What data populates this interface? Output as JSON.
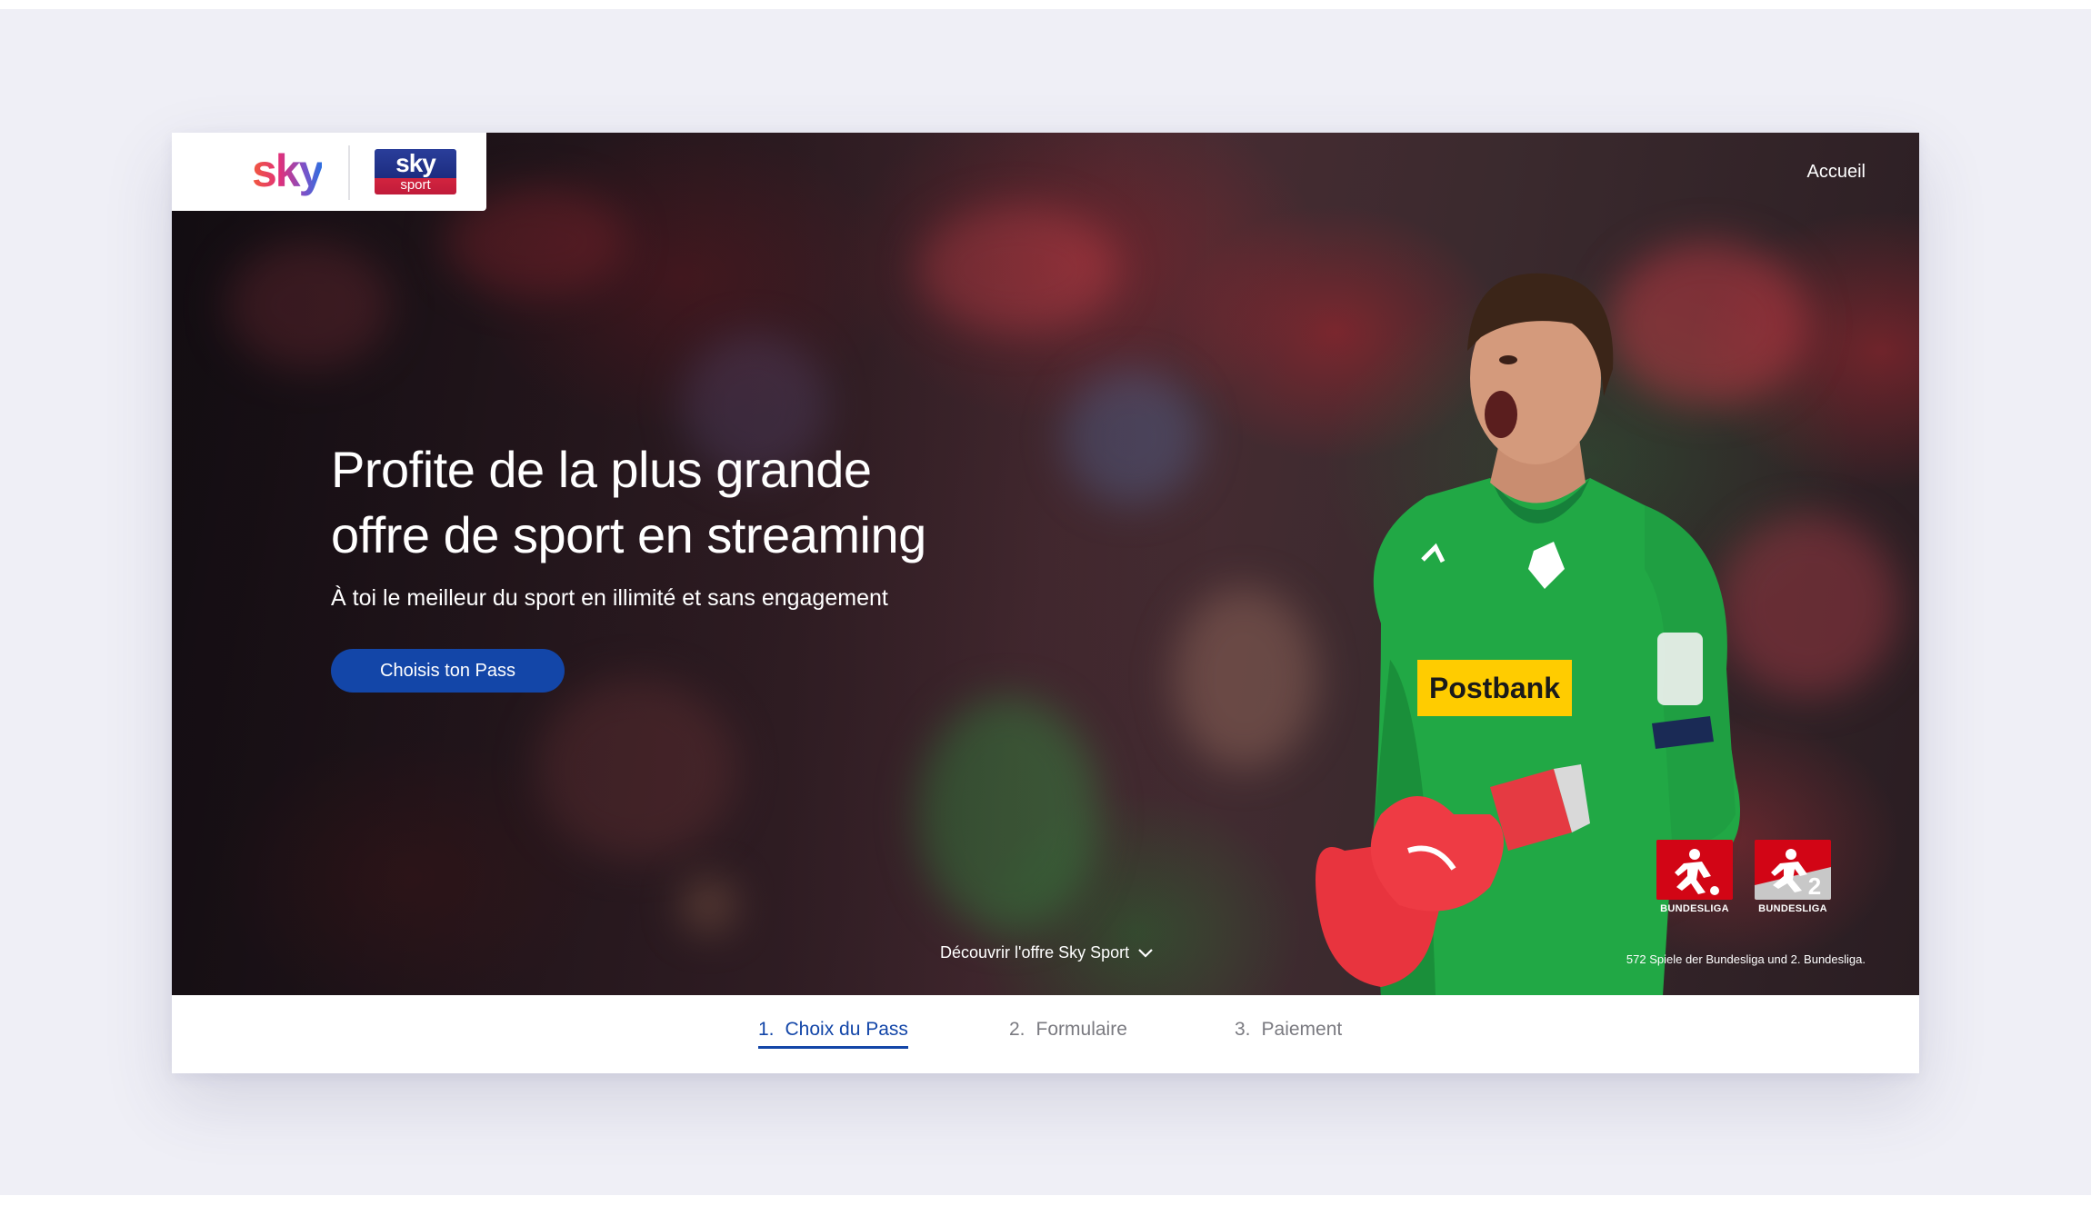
{
  "brand": {
    "sky_logo_text": "sky",
    "sky_sport_logo": {
      "top": "sky",
      "bottom": "sport"
    }
  },
  "nav": {
    "home_label": "Accueil"
  },
  "hero": {
    "headline_line1": "Profite de la plus grande",
    "headline_line2": "offre de sport en streaming",
    "subheadline": "À toi le meilleur du sport en illimité et sans engagement",
    "cta_label": "Choisis ton Pass",
    "discover_link": "Découvrir l'offre Sky Sport",
    "discover_icon": "chevron-down-icon",
    "player_jersey_sponsor": "Postbank"
  },
  "partners": {
    "logos": [
      {
        "icon": "bundesliga-logo-icon",
        "label": "BUNDESLIGA"
      },
      {
        "icon": "bundesliga-2-logo-icon",
        "label": "BUNDESLIGA"
      }
    ],
    "caption": "572 Spiele der Bundesliga und 2. Bundesliga."
  },
  "steps": [
    {
      "number": "1.",
      "label": "Choix du Pass",
      "active": true
    },
    {
      "number": "2.",
      "label": "Formulaire",
      "active": false
    },
    {
      "number": "3.",
      "label": "Paiement",
      "active": false
    }
  ],
  "colors": {
    "accent_blue": "#1346a8",
    "bundesliga_red": "#d20515",
    "page_background": "#efeff6"
  }
}
